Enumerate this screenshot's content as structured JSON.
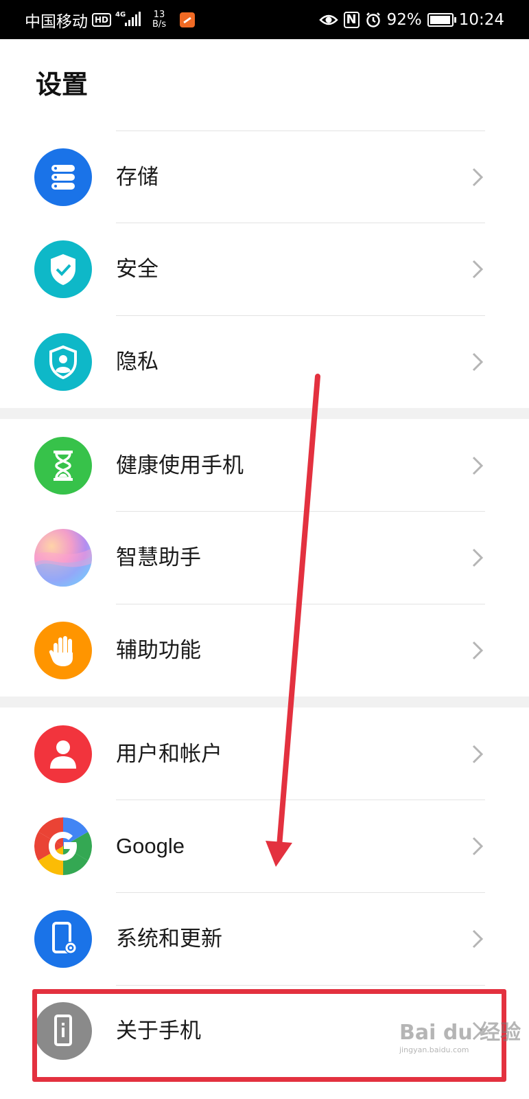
{
  "status_bar": {
    "carrier": "中国移动",
    "hd": "HD",
    "network": "4G",
    "speed_value": "13",
    "speed_unit": "B/s",
    "battery": "92%",
    "time": "10:24",
    "nfc": "N"
  },
  "page": {
    "title": "设置"
  },
  "groups": [
    {
      "items": [
        {
          "label": "存储",
          "icon": "storage-icon",
          "color": "#1a73e8"
        },
        {
          "label": "安全",
          "icon": "shield-check-icon",
          "color": "#0eb8c8"
        },
        {
          "label": "隐私",
          "icon": "privacy-icon",
          "color": "#0eb8c8"
        }
      ]
    },
    {
      "items": [
        {
          "label": "健康使用手机",
          "icon": "hourglass-icon",
          "color": "#37c24a"
        },
        {
          "label": "智慧助手",
          "icon": "assistant-icon",
          "color": "#c98de0"
        },
        {
          "label": "辅助功能",
          "icon": "hand-icon",
          "color": "#ff9500"
        }
      ]
    },
    {
      "items": [
        {
          "label": "用户和帐户",
          "icon": "user-icon",
          "color": "#f2343d"
        },
        {
          "label": "Google",
          "icon": "google-icon",
          "color": "#4285f4"
        },
        {
          "label": "系统和更新",
          "icon": "system-update-icon",
          "color": "#1a73e8"
        },
        {
          "label": "关于手机",
          "icon": "phone-info-icon",
          "color": "#8a8a8a"
        }
      ]
    }
  ],
  "annotation": {
    "color": "#e3313f"
  },
  "watermark": {
    "main": "Bai du 经验",
    "sub": "jingyan.baidu.com"
  }
}
